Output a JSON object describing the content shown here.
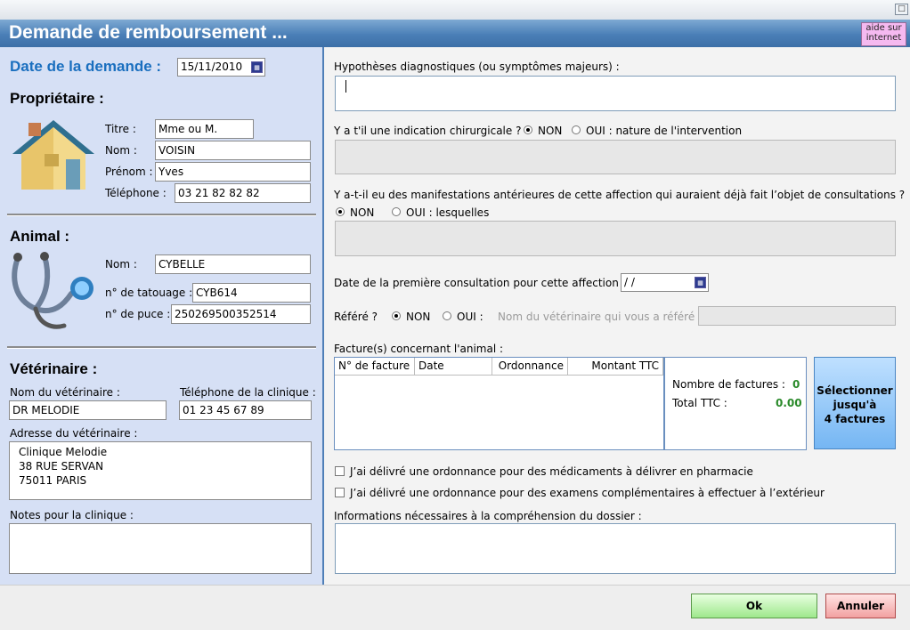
{
  "window": {
    "title": "Demande de remboursement ...",
    "help_button": "aide sur internet",
    "maximize_glyph": "□"
  },
  "left": {
    "date_label": "Date de la demande :",
    "date_value": "15/11/2010",
    "owner": {
      "heading": "Propriétaire :",
      "title_label": "Titre :",
      "title_value": "Mme ou M.",
      "name_label": "Nom :",
      "name_value": "VOISIN",
      "firstname_label": "Prénom :",
      "firstname_value": "Yves",
      "phone_label": "Téléphone :",
      "phone_value": "03 21 82 82 82",
      "icon": "house-icon"
    },
    "animal": {
      "heading": "Animal :",
      "name_label": "Nom :",
      "name_value": "CYBELLE",
      "tattoo_label": "n° de tatouage :",
      "tattoo_value": "CYB614",
      "chip_label": "n° de puce :",
      "chip_value": "250269500352514",
      "icon": "stethoscope-icon"
    },
    "vet": {
      "heading": "Vétérinaire :",
      "name_label": "Nom du vétérinaire :",
      "name_value": "DR MELODIE",
      "clinic_phone_label": "Téléphone de la clinique :",
      "clinic_phone_value": "01 23 45 67 89",
      "address_label": "Adresse du vétérinaire :",
      "address_lines": [
        "Clinique Melodie",
        "38 RUE SERVAN",
        "75011 PARIS"
      ],
      "notes_label": "Notes pour la clinique :",
      "notes_value": ""
    }
  },
  "right": {
    "diagnosis_label": "Hypothèses diagnostiques (ou symptômes majeurs) :",
    "diagnosis_value": "",
    "surgery_question": "Y a t'il une indication chirurgicale ?",
    "surgery_no": "NON",
    "surgery_yes": "OUI : nature de l'intervention",
    "surgery_selected": "NON",
    "prior_question": "Y a-t-il eu des manifestations antérieures de cette affection qui auraient déjà fait l’objet de consultations ?",
    "prior_no": "NON",
    "prior_yes": "OUI : lesquelles",
    "prior_selected": "NON",
    "first_consult_label": "Date de la première consultation pour cette affection ?",
    "first_consult_value": " /  /",
    "referred_label": "Référé ?",
    "referred_no": "NON",
    "referred_yes": "OUI :",
    "referred_selected": "NON",
    "referring_vet_label": "Nom du vétérinaire qui vous a référé :",
    "invoices_label": "Facture(s) concernant l'animal :",
    "invoice_columns": [
      "N° de facture",
      "Date",
      "Ordonnance",
      "Montant TTC"
    ],
    "invoice_count_label": "Nombre de factures :",
    "invoice_count_value": "0",
    "total_label": "Total TTC :",
    "total_value": "0.00",
    "select_button_lines": [
      "Sélectionner",
      "jusqu'à",
      "4 factures"
    ],
    "check_pharmacy": "J’ai délivré une ordonnance pour des médicaments à délivrer en pharmacie",
    "check_exams": "J’ai délivré une ordonnance pour des examens complémentaires à effectuer à l’extérieur",
    "info_label": "Informations nécessaires à la compréhension du dossier :",
    "info_value": ""
  },
  "buttons": {
    "ok": "Ok",
    "cancel": "Annuler"
  },
  "colors": {
    "accent": "#1a6fbf",
    "title_bar": "#4a7fb7",
    "left_panel": "#d6e0f5"
  }
}
